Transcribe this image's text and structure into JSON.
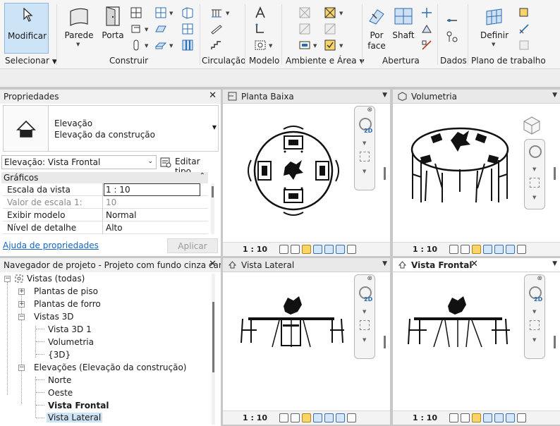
{
  "ribbon": {
    "modify_label": "Modificar",
    "wall_label": "Parede",
    "door_label": "Porta",
    "byface_label_1": "Por",
    "byface_label_2": "face",
    "shaft_label": "Shaft",
    "define_label": "Definir",
    "groups": {
      "select": "Selecionar",
      "build": "Construir",
      "circulation": "Circulação",
      "model": "Modelo",
      "room_area": "Ambiente e Área",
      "opening": "Abertura",
      "datum": "Dados",
      "workplane": "Plano de trabalho"
    }
  },
  "properties": {
    "title": "Propriedades",
    "type_name": "Elevação",
    "type_sub": "Elevação da construção",
    "instance_selector": "Elevação: Vista Frontal",
    "edit_type": "Editar tipo",
    "section": "Gráficos",
    "rows": [
      {
        "key": "Escala da vista",
        "value": "1 : 10"
      },
      {
        "key": "Valor de escala    1:",
        "value": "10"
      },
      {
        "key": "Exibir modelo",
        "value": "Normal"
      },
      {
        "key": "Nível de detalhe",
        "value": "Alto"
      }
    ],
    "help_link": "Ajuda de propriedades",
    "apply": "Aplicar"
  },
  "browser": {
    "title": "Navegador de projeto - Projeto com fundo cinza car...",
    "items": [
      {
        "label": "Vistas (todas)"
      },
      {
        "label": "Plantas de piso"
      },
      {
        "label": "Plantas de forro"
      },
      {
        "label": "Vistas 3D"
      },
      {
        "label": "Vista 3D 1"
      },
      {
        "label": "Volumetria"
      },
      {
        "label": "{3D}"
      },
      {
        "label": "Elevações (Elevação da construção)"
      },
      {
        "label": "Norte"
      },
      {
        "label": "Oeste"
      },
      {
        "label": "Vista Frontal"
      },
      {
        "label": "Vista Lateral"
      }
    ]
  },
  "views": {
    "plan": {
      "title": "Planta Baixa",
      "scale": "1 : 10"
    },
    "volumetry": {
      "title": "Volumetria",
      "scale": "1 : 10"
    },
    "side": {
      "title": "Vista Lateral",
      "scale": "1 : 10"
    },
    "front": {
      "title": "Vista Frontal",
      "scale": "1 : 10"
    }
  },
  "navbar_2d": "2D",
  "colors": {
    "accent": "#2a6db5",
    "link": "#1565c0",
    "selected": "#cde3f6"
  }
}
